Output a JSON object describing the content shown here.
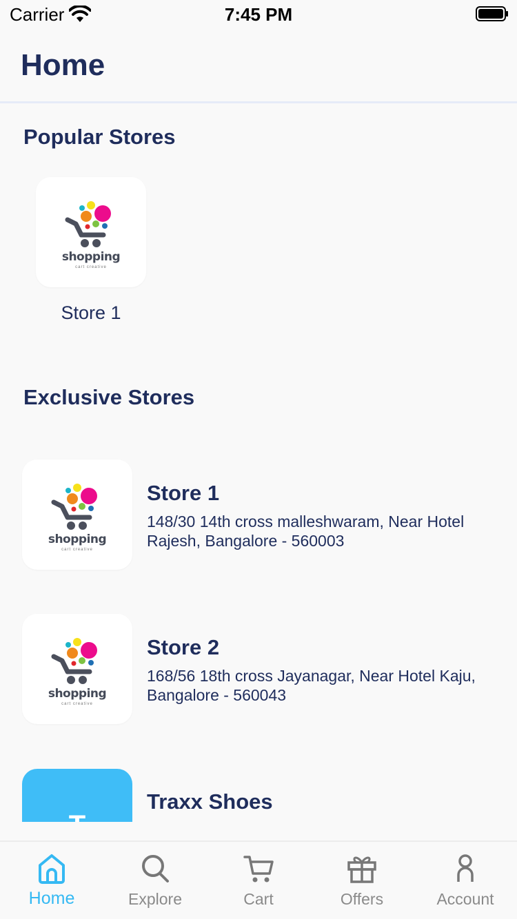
{
  "status_bar": {
    "carrier": "Carrier",
    "time": "7:45 PM"
  },
  "header": {
    "title": "Home"
  },
  "popular": {
    "title": "Popular Stores",
    "stores": [
      {
        "name": "Store 1",
        "logo_text": "shopping",
        "logo_sub": "cart creative"
      }
    ]
  },
  "exclusive": {
    "title": "Exclusive Stores",
    "stores": [
      {
        "name": "Store 1",
        "address": "148/30 14th cross malleshwaram, Near Hotel Rajesh, Bangalore - 560003",
        "logo_text": "shopping",
        "logo_sub": "cart creative"
      },
      {
        "name": "Store 2",
        "address": "168/56 18th cross Jayanagar, Near Hotel Kaju, Bangalore - 560043",
        "logo_text": "shopping",
        "logo_sub": "cart creative"
      },
      {
        "name": "Traxx Shoes",
        "logo_letter": "T"
      }
    ]
  },
  "tabs": [
    {
      "label": "Home",
      "icon": "home-icon",
      "active": true
    },
    {
      "label": "Explore",
      "icon": "search-icon"
    },
    {
      "label": "Cart",
      "icon": "cart-icon"
    },
    {
      "label": "Offers",
      "icon": "gift-icon"
    },
    {
      "label": "Account",
      "icon": "user-icon"
    }
  ],
  "colors": {
    "primary": "#1f2d5c",
    "accent": "#35b9f3",
    "traxx": "#3fbdf7",
    "inactive": "#8a8a8a"
  }
}
